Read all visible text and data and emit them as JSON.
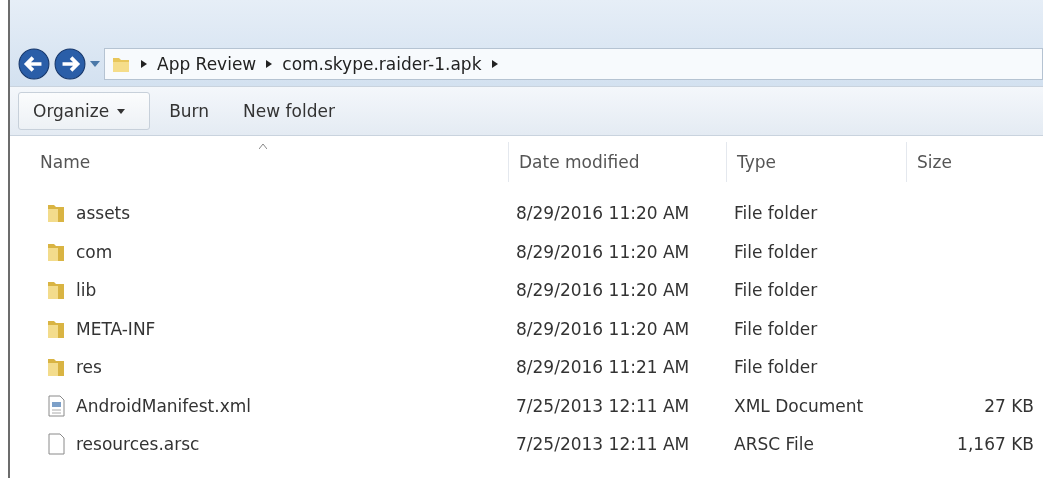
{
  "breadcrumb": [
    "App Review",
    "com.skype.raider-1.apk"
  ],
  "toolbar": [
    {
      "label": "Organize",
      "kind": "menu"
    },
    {
      "label": "Burn",
      "kind": "plain"
    },
    {
      "label": "New folder",
      "kind": "plain"
    }
  ],
  "columns": [
    {
      "label": "Name",
      "sorted": true
    },
    {
      "label": "Date modified",
      "sorted": false
    },
    {
      "label": "Type",
      "sorted": false
    },
    {
      "label": "Size",
      "sorted": false
    }
  ],
  "rows": [
    {
      "kind": "folder",
      "name": "assets",
      "date": "8/29/2016 11:20 AM",
      "type": "File folder"
    },
    {
      "kind": "folder",
      "name": "com",
      "date": "8/29/2016 11:20 AM",
      "type": "File folder"
    },
    {
      "kind": "folder",
      "name": "lib",
      "date": "8/29/2016 11:20 AM",
      "type": "File folder"
    },
    {
      "kind": "folder",
      "name": "META-INF",
      "date": "8/29/2016 11:20 AM",
      "type": "File folder"
    },
    {
      "kind": "folder",
      "name": "res",
      "date": "8/29/2016 11:21 AM",
      "type": "File folder"
    },
    {
      "kind": "xml",
      "name": "AndroidManifest.xml",
      "date": "7/25/2013 12:11 AM",
      "type": "XML Document",
      "size": "27 KB"
    },
    {
      "kind": "file",
      "name": "resources.arsc",
      "date": "7/25/2013 12:11 AM",
      "type": "ARSC File",
      "size": "1,167 KB"
    }
  ]
}
